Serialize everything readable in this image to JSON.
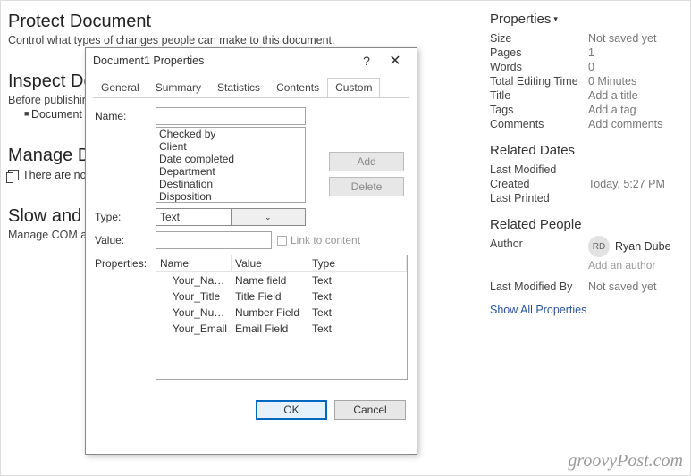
{
  "left": {
    "protect": {
      "title": "Protect Document",
      "desc": "Control what types of changes people can make to this document."
    },
    "inspect": {
      "title": "Inspect Document",
      "desc_prefix": "Before publishing",
      "bullet": "Document properties"
    },
    "manage": {
      "title": "Manage Document",
      "desc": "There are no unsaved changes."
    },
    "slow": {
      "title": "Slow and Disabled COM Add-ins",
      "desc": "Manage COM add-ins"
    }
  },
  "props": {
    "header": "Properties",
    "rows": [
      {
        "label": "Size",
        "value": "Not saved yet"
      },
      {
        "label": "Pages",
        "value": "1"
      },
      {
        "label": "Words",
        "value": "0"
      },
      {
        "label": "Total Editing Time",
        "value": "0 Minutes"
      },
      {
        "label": "Title",
        "value": "Add a title"
      },
      {
        "label": "Tags",
        "value": "Add a tag"
      },
      {
        "label": "Comments",
        "value": "Add comments"
      }
    ],
    "dates_header": "Related Dates",
    "dates": [
      {
        "label": "Last Modified",
        "value": ""
      },
      {
        "label": "Created",
        "value": "Today, 5:27 PM"
      },
      {
        "label": "Last Printed",
        "value": ""
      }
    ],
    "people_header": "Related People",
    "author_label": "Author",
    "author_initials": "RD",
    "author_name": "Ryan Dube",
    "add_author": "Add an author",
    "modified_label": "Last Modified By",
    "modified_value": "Not saved yet",
    "show_all": "Show All Properties"
  },
  "dialog": {
    "title": "Document1 Properties",
    "tabs": [
      "General",
      "Summary",
      "Statistics",
      "Contents",
      "Custom"
    ],
    "active_tab": 4,
    "labels": {
      "name": "Name:",
      "type": "Type:",
      "value": "Value:",
      "properties": "Properties:",
      "link": "Link to content"
    },
    "name_value": "",
    "name_list": [
      "Checked by",
      "Client",
      "Date completed",
      "Department",
      "Destination",
      "Disposition"
    ],
    "type_value": "Text",
    "value_value": "",
    "add_btn": "Add",
    "delete_btn": "Delete",
    "columns": [
      "Name",
      "Value",
      "Type"
    ],
    "rows": [
      {
        "name": "Your_Name",
        "value": "Name field",
        "type": "Text"
      },
      {
        "name": "Your_Title",
        "value": "Title Field",
        "type": "Text"
      },
      {
        "name": "Your_Nu…",
        "value": "Number Field",
        "type": "Text"
      },
      {
        "name": "Your_Email",
        "value": "Email Field",
        "type": "Text"
      }
    ],
    "ok": "OK",
    "cancel": "Cancel"
  },
  "watermark": "groovyPost.com"
}
